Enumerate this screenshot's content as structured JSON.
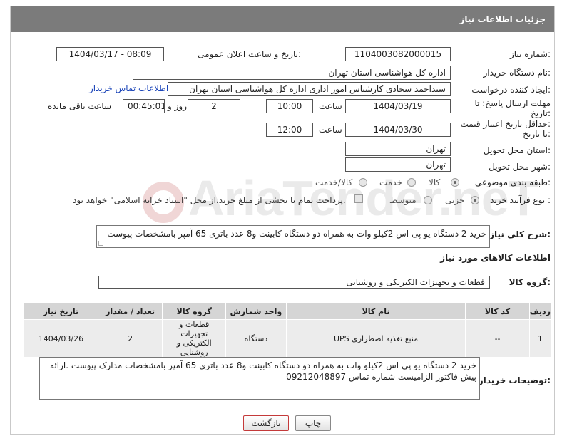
{
  "header": {
    "title": "جزئیات اطلاعات نیاز"
  },
  "fields": {
    "need_number_label": "شماره نیاز:",
    "need_number": "1104003082000015",
    "announce_label": "تاریخ و ساعت اعلان عمومی:",
    "announce_value": "1404/03/17 - 08:09",
    "buyer_org_label": "نام دستگاه خریدار:",
    "buyer_org": "اداره کل هواشناسی استان تهران",
    "creator_label": "ایجاد کننده درخواست:",
    "creator": "سیداحمد سجادی کارشناس امور اداری اداره کل هواشناسی استان تهران",
    "contact_link": "اطلاعات تماس خریدار",
    "deadline_label_1": "مهلت ارسال پاسخ: تا",
    "deadline_label_2": "تاریخ:",
    "deadline_date": "1404/03/19",
    "time_label": "ساعت",
    "deadline_time": "10:00",
    "days_value": "2",
    "days_label": "روز و",
    "remaining_time": "00:45:01",
    "remaining_label": "ساعت باقی مانده",
    "validity_label_1": "حداقل تاریخ اعتبار قیمت:",
    "validity_label_2": "تا تاریخ:",
    "validity_date": "1404/03/30",
    "validity_time": "12:00",
    "province_label": "استان محل تحویل:",
    "province": "تهران",
    "city_label": "شهر محل تحویل:",
    "city": "تهران",
    "category_label": "طبقه بندی موضوعی:",
    "category_options": [
      "کالا",
      "خدمت",
      "کالا/خدمت"
    ],
    "category_selected": "کالا",
    "process_label": "نوع فرآیند خرید :",
    "process_options": [
      "جزیی",
      "متوسط"
    ],
    "process_selected": "جزیی",
    "payment_note": "پرداخت تمام یا بخشی از مبلغ خرید،از محل \"اسناد خزانه اسلامی\" خواهد بود.",
    "general_desc_label": "شرح کلی نیاز:",
    "general_desc": "خرید 2 دستگاه یو پی اس  2کیلو وات  به همراه دو دستگاه کابینت و8 عدد باتری 65  آمپر بامشخصات پیوست",
    "goods_info_title": "اطلاعات کالاهای مورد نیاز",
    "goods_group_label": "گروه کالا:",
    "goods_group": "قطعات و تجهیزات الکتریکی و روشنایی",
    "buyer_notes_label": "توضیحات خریدار:",
    "buyer_notes": "خرید 2 دستگاه یو پی اس  2کیلو وات  به همراه دو دستگاه کابینت و8 عدد باتری 65  آمپر بامشخصات مدارک پیوست .ارائه پیش فاکتور الزامیست  شماره تماس 09212048897"
  },
  "table": {
    "headers": [
      "ردیف",
      "کد کالا",
      "نام کالا",
      "واحد شمارش",
      "گروه کالا",
      "تعداد / مقدار",
      "تاریخ نیاز"
    ],
    "rows": [
      [
        "1",
        "--",
        "منبع تغذیه اضطراری UPS",
        "دستگاه",
        "قطعات و تجهیزات الکتریکی و روشنایی",
        "2",
        "1404/03/26"
      ]
    ]
  },
  "buttons": {
    "print": "چاپ",
    "back": "بازگشت"
  },
  "watermark": "AriaTender.neT",
  "colors": {
    "header_bg": "#7b7b7b",
    "link": "#1a44b8",
    "table_header": "#d5d5d5",
    "table_cell": "#ececec",
    "back_button_border": "#c43a3a"
  }
}
